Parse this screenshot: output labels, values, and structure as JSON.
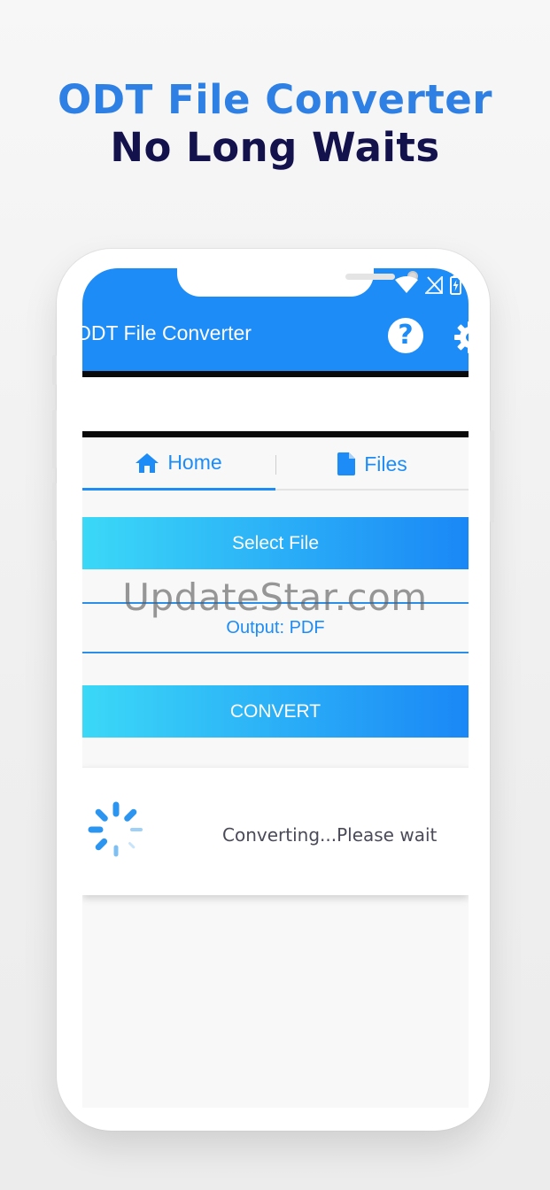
{
  "promo": {
    "headline_1": "ODT File Converter",
    "headline_2": "No Long Waits"
  },
  "app": {
    "title": "ODT File Converter",
    "help_label": "?"
  },
  "tabs": [
    {
      "label": "Home",
      "icon": "home-icon",
      "active": true
    },
    {
      "label": "Files",
      "icon": "file-icon",
      "active": false
    }
  ],
  "main": {
    "select_button": "Select File",
    "output_label": "Output: PDF",
    "convert_button": "CONVERT"
  },
  "progress_dialog": {
    "message": "Converting...Please wait"
  },
  "watermark": "UpdateStar.com",
  "colors": {
    "accent": "#1d8cf7",
    "headline_blue": "#2f80e4",
    "headline_navy": "#14124d",
    "gradient_start": "#3bd8f7",
    "gradient_end": "#1a87f6"
  }
}
